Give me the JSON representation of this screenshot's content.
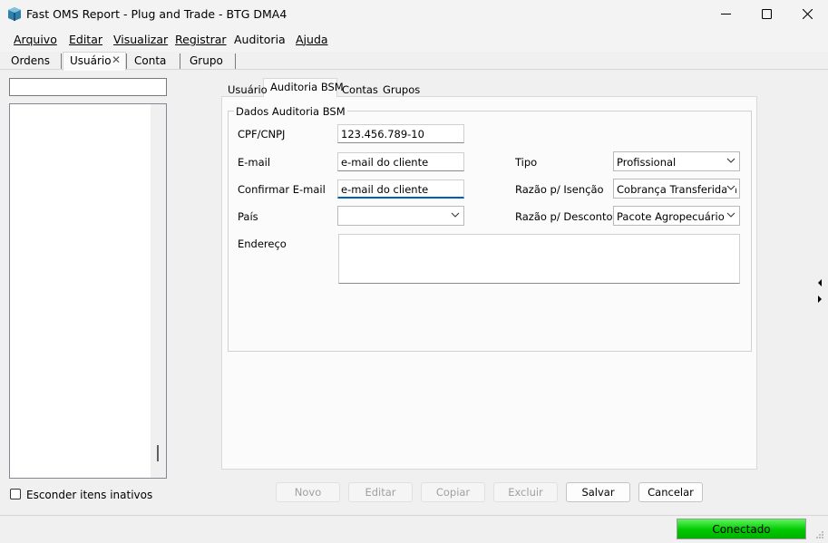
{
  "window": {
    "title": "Fast OMS Report - Plug and Trade - BTG DMA4",
    "minimize_icon": "minimize-icon",
    "maximize_icon": "maximize-icon",
    "close_icon": "close-icon"
  },
  "menu": {
    "items": [
      "Arquivo",
      "Editar",
      "Visualizar",
      "Registrar",
      "Auditoria",
      "Ajuda"
    ]
  },
  "top_tabs": {
    "items": [
      "Ordens",
      "Usuário",
      "Conta",
      "Grupo"
    ],
    "active": "Usuário",
    "close_glyph": "✕"
  },
  "left_panel": {
    "search_value": "",
    "hide_inactive_label": "Esconder itens inativos",
    "hide_inactive_checked": false
  },
  "inner_tabs": {
    "items": [
      "Usuário",
      "Auditoria BSM",
      "Contas",
      "Grupos"
    ],
    "active": "Auditoria BSM"
  },
  "form": {
    "group_title": "Dados Auditoria BSM",
    "cpf_label": "CPF/CNPJ",
    "cpf_value": "123.456.789-10",
    "email_label": "E-mail",
    "email_value": "e-mail do cliente",
    "confirm_email_label": "Confirmar E-mail",
    "confirm_email_value": "e-mail do cliente",
    "pais_label": "País",
    "pais_value": "",
    "endereco_label": "Endereço",
    "endereco_value": "",
    "tipo_label": "Tipo",
    "tipo_value": "Profissional",
    "isencao_label": "Razão p/ Isenção",
    "isencao_value": "Cobrança Transferida a (",
    "desconto_label": "Razão p/ Desconto",
    "desconto_value": "Pacote Agropecuário"
  },
  "buttons": {
    "novo": "Novo",
    "editar": "Editar",
    "copiar": "Copiar",
    "excluir": "Excluir",
    "salvar": "Salvar",
    "cancelar": "Cancelar"
  },
  "status": {
    "connection": "Conectado",
    "connection_color": "#00c800"
  }
}
